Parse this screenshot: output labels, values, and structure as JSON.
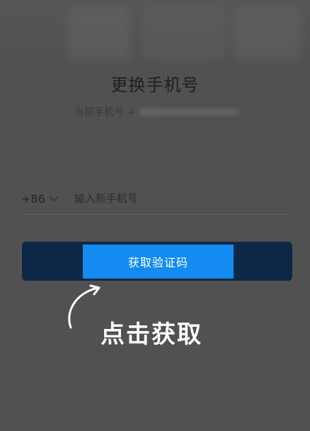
{
  "page": {
    "title": "更换手机号",
    "current_phone_label": "当前手机号 +"
  },
  "form": {
    "country_code": "+86",
    "phone_placeholder": "输入新手机号",
    "phone_value": ""
  },
  "actions": {
    "get_code_label": "获取验证码"
  },
  "tutorial": {
    "hint_text": "点击获取"
  },
  "colors": {
    "button": "#138bf0",
    "highlight_frame": "#0d2746",
    "overlay": "#515151"
  }
}
